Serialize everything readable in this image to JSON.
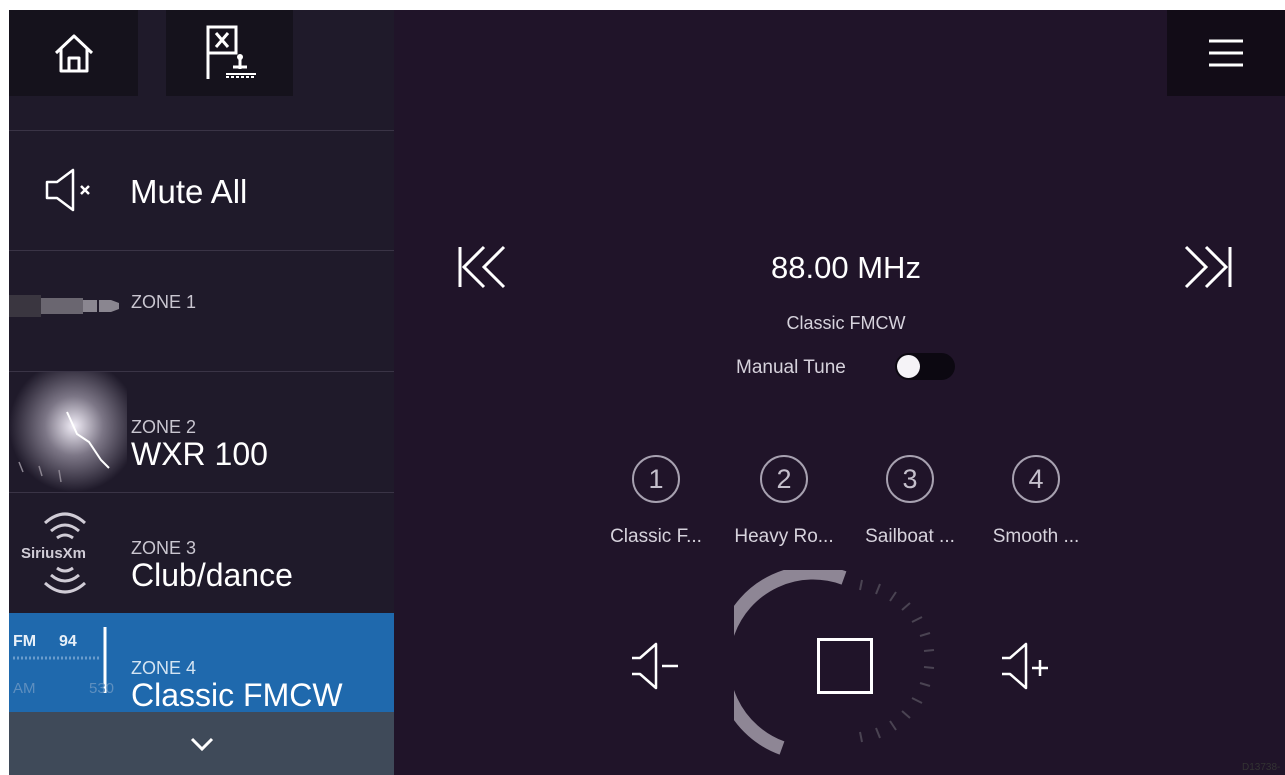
{
  "sidebar": {
    "mute_label": "Mute All",
    "zones": [
      {
        "tag": "ZONE 1",
        "name": "",
        "source": "aux-jack"
      },
      {
        "tag": "ZONE 2",
        "name": "WXR 100",
        "source": "weather"
      },
      {
        "tag": "ZONE 3",
        "name": "Club/dance",
        "source": "siriusxm"
      },
      {
        "tag": "ZONE 4",
        "name": "Classic FMCW",
        "source": "fm-am-radio",
        "selected": true
      }
    ],
    "siriusxm_logo": "SiriusXm",
    "radio_thumb": {
      "fm": "FM",
      "fm_value": "94",
      "am": "AM",
      "am_value": "530"
    }
  },
  "player": {
    "frequency": "88.00 MHz",
    "station": "Classic FMCW",
    "manual_tune_label": "Manual Tune",
    "manual_tune_on": false,
    "presets": [
      {
        "number": "1",
        "label": "Classic F..."
      },
      {
        "number": "2",
        "label": "Heavy Ro..."
      },
      {
        "number": "3",
        "label": "Sailboat ..."
      },
      {
        "number": "4",
        "label": "Smooth ..."
      }
    ]
  },
  "colors": {
    "sidebar_bg": "#1f1a2a",
    "main_bg": "#201429",
    "selected_zone": "#1f69ad"
  },
  "reference_code": "D13738-"
}
